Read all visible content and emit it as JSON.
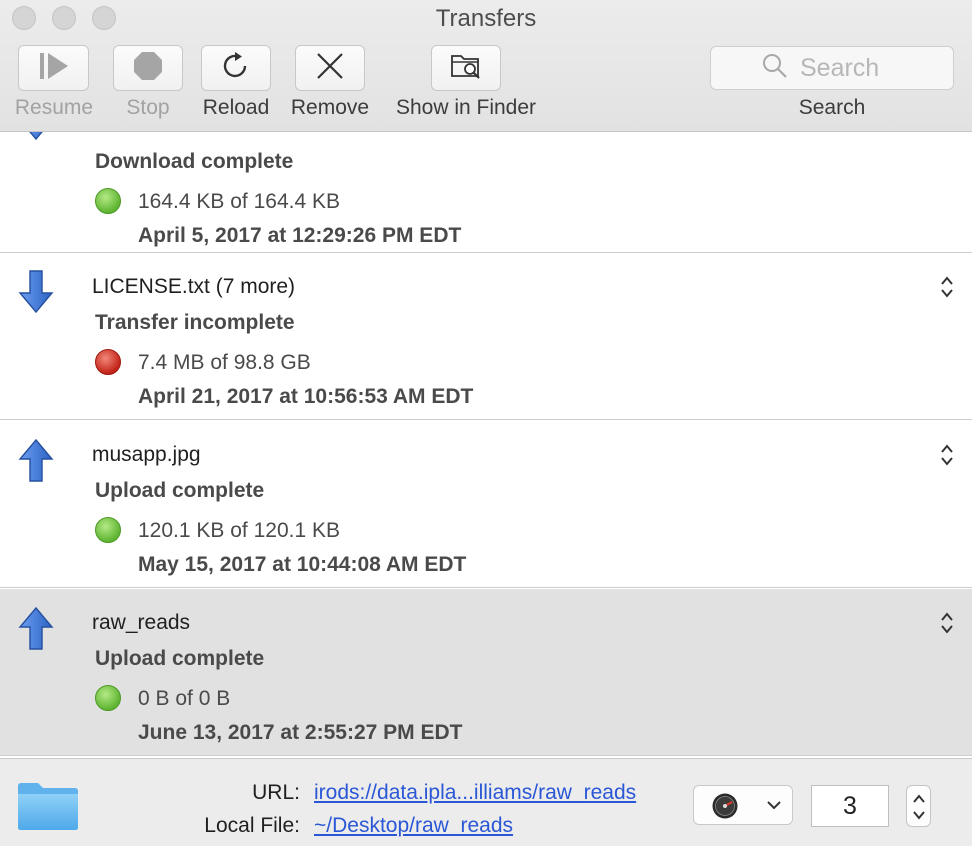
{
  "window": {
    "title": "Transfers"
  },
  "toolbar": {
    "resume_label": "Resume",
    "stop_label": "Stop",
    "reload_label": "Reload",
    "remove_label": "Remove",
    "show_in_finder_label": "Show in Finder",
    "search_placeholder": "Search",
    "search_label": "Search"
  },
  "transfers": [
    {
      "direction": "download",
      "name": "",
      "status": "Download complete",
      "state": "complete",
      "size": "164.4 KB of 164.4 KB",
      "date": "April 5, 2017 at 12:29:26 PM EDT"
    },
    {
      "direction": "download",
      "name": "LICENSE.txt (7 more)",
      "status": "Transfer incomplete",
      "state": "incomplete",
      "size": "7.4 MB of 98.8 GB",
      "date": "April 21, 2017 at 10:56:53 AM EDT"
    },
    {
      "direction": "upload",
      "name": "musapp.jpg",
      "status": "Upload complete",
      "state": "complete",
      "size": "120.1 KB of 120.1 KB",
      "date": "May 15, 2017 at 10:44:08 AM EDT"
    },
    {
      "direction": "upload",
      "name": "raw_reads",
      "status": "Upload complete",
      "state": "complete",
      "size": "0 B of 0 B",
      "date": "June 13, 2017 at 2:55:27 PM EDT"
    }
  ],
  "footer": {
    "url_label": "URL:",
    "url_value": "irods://data.ipla...illiams/raw_reads",
    "local_file_label": "Local File:",
    "local_file_value": "~/Desktop/raw_reads",
    "connections_count": "3"
  },
  "colors": {
    "complete_dot": "#6cc041",
    "incomplete_dot": "#c8261e",
    "arrow_blue": "#3d78d8",
    "link_blue": "#2a57d6",
    "selected_row": "#e1e1e1"
  },
  "icons": {
    "download": "arrow-down-icon",
    "upload": "arrow-up-icon",
    "folder": "folder-icon",
    "stepper": "up-down-chevron-icon"
  }
}
